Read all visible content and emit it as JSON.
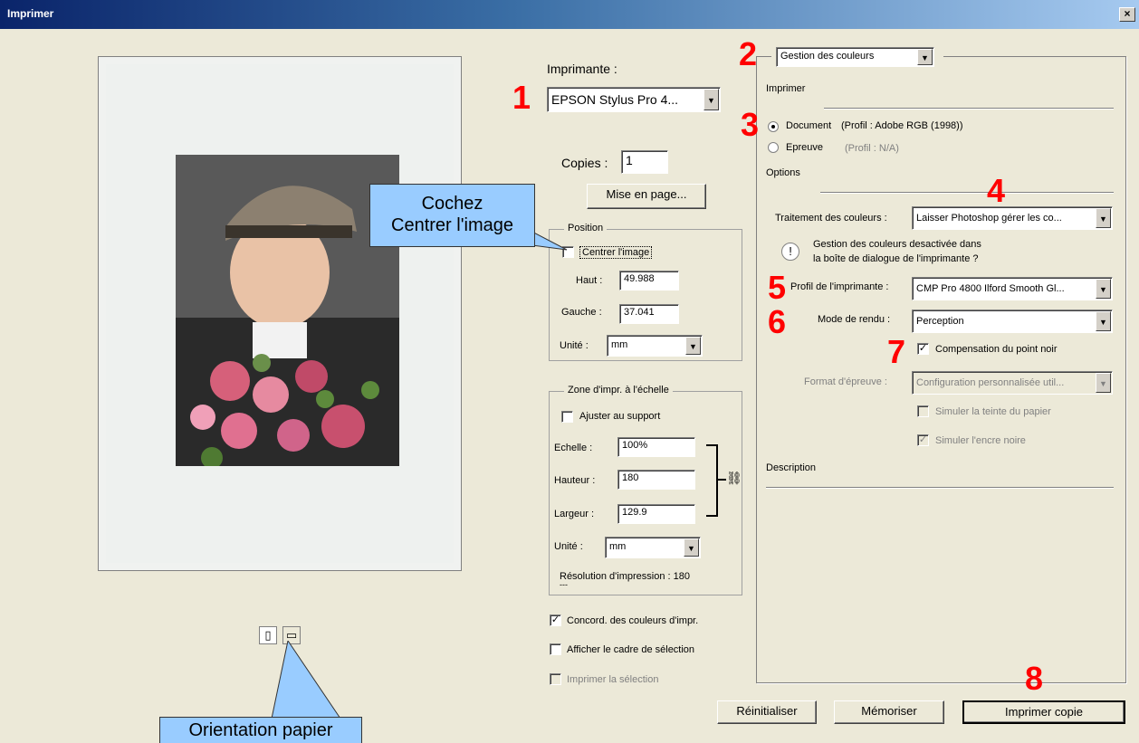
{
  "window": {
    "title": "Imprimer",
    "close_glyph": "×"
  },
  "printer": {
    "label": "Imprimante :",
    "selected": "EPSON Stylus Pro 4...",
    "copies_label": "Copies :",
    "copies_value": "1",
    "page_setup_button": "Mise en page..."
  },
  "position": {
    "legend": "Position",
    "center_image_label": "Centrer l'image",
    "top_label": "Haut :",
    "top_value": "49.988",
    "left_label": "Gauche :",
    "left_value": "37.041",
    "unit_label": "Unité :",
    "unit_value": "mm"
  },
  "scale": {
    "legend": "Zone d'impr. à l'échelle",
    "fit_media_label": "Ajuster au support",
    "scale_label": "Echelle :",
    "scale_value": "100%",
    "height_label": "Hauteur :",
    "height_value": "180",
    "width_label": "Largeur :",
    "width_value": "129.9",
    "unit_label": "Unité :",
    "unit_value": "mm",
    "resolution_text": "Résolution d'impression : 180",
    "resolution_sub": "---"
  },
  "bottom_checks": {
    "match_colors": "Concord. des couleurs d'impr.",
    "show_bbox": "Afficher le cadre de sélection",
    "print_selection": "Imprimer la sélection"
  },
  "color_mgmt": {
    "section_select": "Gestion des couleurs",
    "print_heading": "Imprimer",
    "document_label": "Document",
    "document_profile": "(Profil : Adobe RGB (1998))",
    "proof_label": "Epreuve",
    "proof_profile": "(Profil : N/A)",
    "options_heading": "Options",
    "color_handling_label": "Traitement des couleurs :",
    "color_handling_value": "Laisser Photoshop gérer les co...",
    "warning_line1": "Gestion des couleurs desactivée dans",
    "warning_line2": "la boîte de dialogue de l'imprimante ?",
    "printer_profile_label": "Profil de l'imprimante :",
    "printer_profile_value": "CMP Pro 4800 Ilford Smooth Gl...",
    "rendering_intent_label": "Mode de rendu :",
    "rendering_intent_value": "Perception",
    "black_point_label": "Compensation du point noir",
    "proof_setup_label": "Format d'épreuve :",
    "proof_setup_value": "Configuration personnalisée util...",
    "simulate_paper_label": "Simuler la teinte du papier",
    "simulate_ink_label": "Simuler l'encre noire",
    "description_heading": "Description"
  },
  "buttons": {
    "reset": "Réinitialiser",
    "remember": "Mémoriser",
    "print_copy": "Imprimer copie"
  },
  "annotations": {
    "n1": "1",
    "n2": "2",
    "n3": "3",
    "n4": "4",
    "n5": "5",
    "n6": "6",
    "n7": "7",
    "n8": "8",
    "callout_center_line1": "Cochez",
    "callout_center_line2": "Centrer l'image",
    "callout_orientation": "Orientation papier"
  },
  "colors": {
    "annotation_red": "#ff0000",
    "callout_blue": "#99ccff"
  }
}
